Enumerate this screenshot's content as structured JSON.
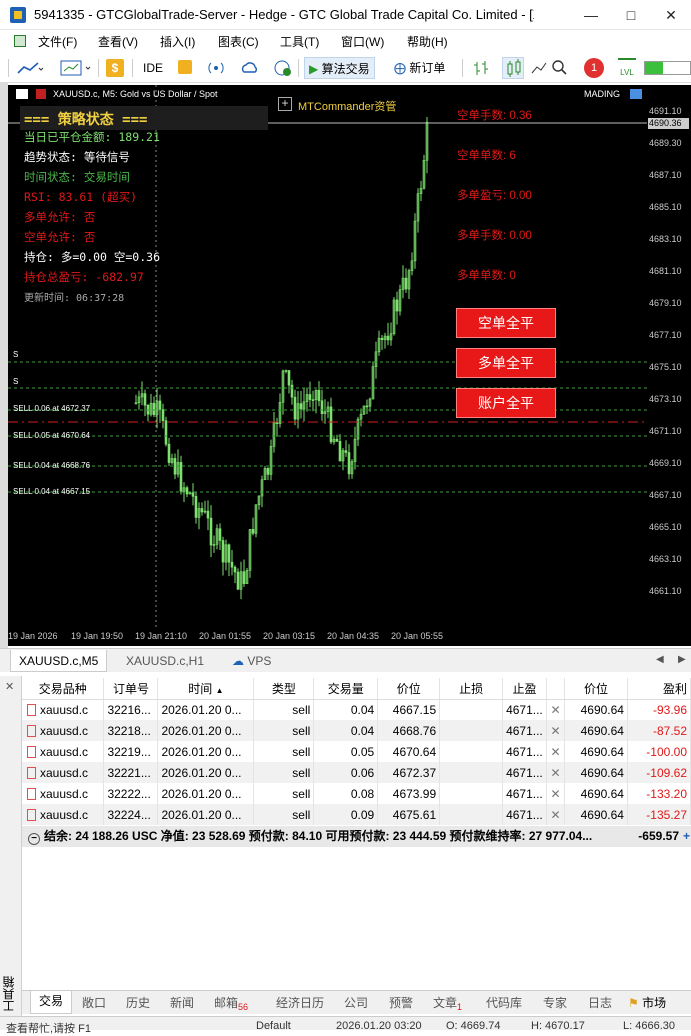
{
  "window": {
    "title": "5941335 - GTCGlobalTrade-Server - Hedge - GTC Global Trade Capital Co. Limited - [XA..."
  },
  "menu": [
    "文件(F)",
    "查看(V)",
    "插入(I)",
    "图表(C)",
    "工具(T)",
    "窗口(W)",
    "帮助(H)"
  ],
  "toolbar": {
    "ide": "IDE",
    "algo": "算法交易",
    "new_order": "新订单",
    "notif_count": "1"
  },
  "chart": {
    "symbol": "XAUUSD.c, M5:  Gold vs US Dollar / Spot",
    "commander": "MTCommander资管",
    "watermark": "MADING",
    "panel_title": "=== 策略状态 ===",
    "panel": {
      "closed_today": "当日已平仓金额: 189.21",
      "trend": "趋势状态: 等待信号",
      "time": "时间状态: 交易时间",
      "rsi": "RSI: 83.61 (超买)",
      "long_allowed": "多单允许: 否",
      "short_allowed": "空单允许: 否",
      "position": "持仓: 多=0.00 空=0.36",
      "total_pl": "持仓总盈亏: -682.97",
      "update": "更新时间: 06:37:28"
    },
    "right_stats": {
      "short_lots": "空单手数: 0.36",
      "short_count": "空单单数: 6",
      "long_pl": "多单盈亏: 0.00",
      "long_lots": "多单手数: 0.00",
      "long_count": "多单单数: 0"
    },
    "buttons": {
      "close_short": "空单全平",
      "close_long": "多单全平",
      "close_all": "账户全平"
    },
    "sell_labels": [
      "SELL 0.06 at 4672.37",
      "SELL 0.05 at 4670.64",
      "SELL 0.04 at 4668.76",
      "SELL 0.04 at 4667.15"
    ],
    "s_marks": [
      "S",
      "S"
    ],
    "price_axis": [
      "4691.10",
      "4689.30",
      "4687.10",
      "4685.10",
      "4683.10",
      "4681.10",
      "4679.10",
      "4677.10",
      "4675.10",
      "4673.10",
      "4671.10",
      "4669.10",
      "4667.10",
      "4665.10",
      "4663.10",
      "4661.10"
    ],
    "current_price": "4690.36",
    "time_axis": [
      "19 Jan 2026",
      "19 Jan 19:50",
      "19 Jan 21:10",
      "20 Jan 01:55",
      "20 Jan 03:15",
      "20 Jan 04:35",
      "20 Jan 05:55"
    ],
    "colors": {
      "bg": "#000000",
      "candle": "#7ee06e",
      "sell_line": "#3aa03a",
      "red_line": "#d02020"
    }
  },
  "chart_tabs": [
    "XAUUSD.c,M5",
    "XAUUSD.c,H1",
    "VPS"
  ],
  "terminal": {
    "side_label": "工具箱",
    "headers": [
      "交易品种",
      "订单号",
      "时间",
      "类型",
      "交易量",
      "价位",
      "止损",
      "止盈",
      "",
      "价位",
      "盈利"
    ],
    "rows": [
      {
        "symbol": "xauusd.c",
        "ticket": "32216...",
        "time": "2026.01.20 0...",
        "type": "sell",
        "volume": "0.04",
        "price": "4667.15",
        "sl": "",
        "tp": "4671...",
        "cur": "4690.64",
        "profit": "-93.96"
      },
      {
        "symbol": "xauusd.c",
        "ticket": "32218...",
        "time": "2026.01.20 0...",
        "type": "sell",
        "volume": "0.04",
        "price": "4668.76",
        "sl": "",
        "tp": "4671...",
        "cur": "4690.64",
        "profit": "-87.52"
      },
      {
        "symbol": "xauusd.c",
        "ticket": "32219...",
        "time": "2026.01.20 0...",
        "type": "sell",
        "volume": "0.05",
        "price": "4670.64",
        "sl": "",
        "tp": "4671...",
        "cur": "4690.64",
        "profit": "-100.00"
      },
      {
        "symbol": "xauusd.c",
        "ticket": "32221...",
        "time": "2026.01.20 0...",
        "type": "sell",
        "volume": "0.06",
        "price": "4672.37",
        "sl": "",
        "tp": "4671...",
        "cur": "4690.64",
        "profit": "-109.62"
      },
      {
        "symbol": "xauusd.c",
        "ticket": "32222...",
        "time": "2026.01.20 0...",
        "type": "sell",
        "volume": "0.08",
        "price": "4673.99",
        "sl": "",
        "tp": "4671...",
        "cur": "4690.64",
        "profit": "-133.20"
      },
      {
        "symbol": "xauusd.c",
        "ticket": "32224...",
        "time": "2026.01.20 0...",
        "type": "sell",
        "volume": "0.09",
        "price": "4675.61",
        "sl": "",
        "tp": "4671...",
        "cur": "4690.64",
        "profit": "-135.27"
      }
    ],
    "summary": "结余: 24 188.26 USC  净值: 23 528.69  预付款: 84.10  可用预付款: 23 444.59  预付款维持率: 27 977.04...",
    "summary_total": "-659.57",
    "tabs": [
      "交易",
      "敞口",
      "历史",
      "新闻",
      "邮箱",
      "经济日历",
      "公司",
      "预警",
      "文章",
      "代码库",
      "专家",
      "日志",
      "市场"
    ],
    "mail_count": "56",
    "articles_count": "1"
  },
  "status": {
    "help": "查看帮忙,请按 F1",
    "profile": "Default",
    "time": "2026.01.20 03:20",
    "open": "O: 4669.74",
    "high": "H: 4670.17",
    "low": "L: 4666.30"
  }
}
